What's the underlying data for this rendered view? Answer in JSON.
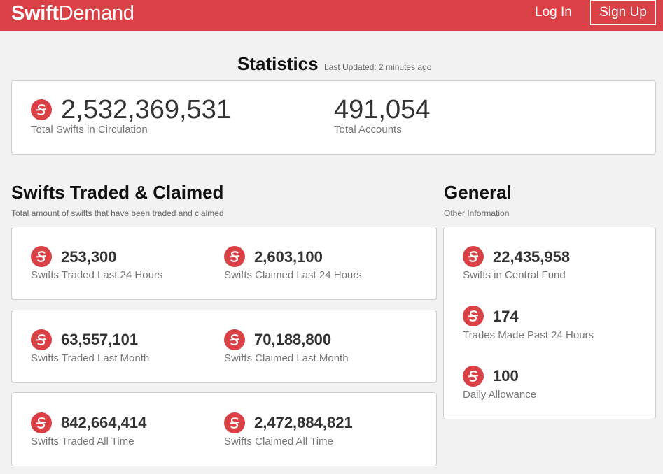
{
  "header": {
    "logo_bold": "Swift",
    "logo_light": "Demand",
    "login_label": "Log In",
    "signup_label": "Sign Up",
    "brand_color": "#d94147"
  },
  "statistics": {
    "title": "Statistics",
    "last_updated": "Last Updated: 2 minutes ago",
    "total_swifts_value": "2,532,369,531",
    "total_swifts_label": "Total Swifts in Circulation",
    "total_accounts_value": "491,054",
    "total_accounts_label": "Total Accounts"
  },
  "traded_claimed": {
    "title": "Swifts Traded & Claimed",
    "subtitle": "Total amount of swifts that have been traded and claimed",
    "cards": [
      {
        "left": {
          "value": "253,300",
          "label": "Swifts Traded Last 24 Hours"
        },
        "right": {
          "value": "2,603,100",
          "label": "Swifts Claimed Last 24 Hours"
        }
      },
      {
        "left": {
          "value": "63,557,101",
          "label": "Swifts Traded Last Month"
        },
        "right": {
          "value": "70,188,800",
          "label": "Swifts Claimed Last Month"
        }
      },
      {
        "left": {
          "value": "842,664,414",
          "label": "Swifts Traded All Time"
        },
        "right": {
          "value": "2,472,884,821",
          "label": "Swifts Claimed All Time"
        }
      }
    ]
  },
  "general": {
    "title": "General",
    "subtitle": "Other Information",
    "items": [
      {
        "value": "22,435,958",
        "label": "Swifts in Central Fund"
      },
      {
        "value": "174",
        "label": "Trades Made Past 24 Hours"
      },
      {
        "value": "100",
        "label": "Daily Allowance"
      }
    ]
  },
  "icons": {
    "coin": "swift-coin-icon"
  }
}
